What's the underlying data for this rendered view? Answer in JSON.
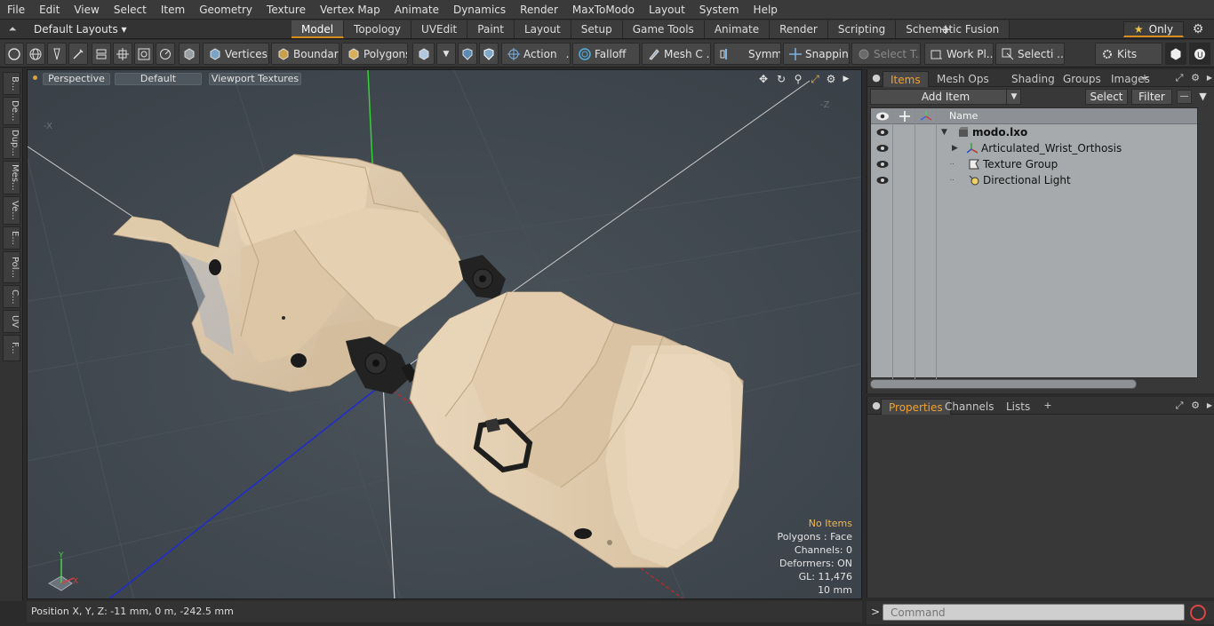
{
  "menu": [
    "File",
    "Edit",
    "View",
    "Select",
    "Item",
    "Geometry",
    "Texture",
    "Vertex Map",
    "Animate",
    "Dynamics",
    "Render",
    "MaxToModo",
    "Layout",
    "System",
    "Help"
  ],
  "layout_bar": {
    "layouts_label": "Default Layouts",
    "tabs": [
      "Model",
      "Topology",
      "UVEdit",
      "Paint",
      "Layout",
      "Setup",
      "Game Tools",
      "Animate",
      "Render",
      "Scripting",
      "Schematic Fusion"
    ],
    "active_tab": "Model",
    "only_label": "Only"
  },
  "toolbar": {
    "vertices": "Vertices",
    "boundary": "Boundary",
    "polygons": "Polygons",
    "action": "Action",
    "falloff": "Falloff",
    "mesh": "Mesh C ...",
    "symmetry": "Symm ...",
    "snapping": "Snapping",
    "select_t": "Select T...",
    "work_plane": "Work Pl...",
    "selection": "Selecti ...",
    "kits": "Kits"
  },
  "left_tabs": [
    "B...",
    "De...",
    "Dup...",
    "Mes...",
    "Ve...",
    "E...",
    "Pol...",
    "C...",
    "UV",
    "F..."
  ],
  "viewport": {
    "view_mode": "Perspective",
    "shading": "Default",
    "textures": "Viewport Textures",
    "info": {
      "selection": "No Items",
      "polygons": "Polygons : Face",
      "channels": "Channels: 0",
      "deformers": "Deformers: ON",
      "gl": "GL: 11,476",
      "scale": "10 mm"
    },
    "axis_x": "X",
    "axis_y": "Y"
  },
  "status": {
    "position": "Position X, Y, Z:  -11 mm, 0 m, -242.5 mm"
  },
  "items_panel": {
    "tabs": [
      "Items",
      "Mesh Ops",
      "Shading",
      "Groups",
      "Images"
    ],
    "active_tab": "Items",
    "add_item": "Add Item",
    "select": "Select",
    "filter": "Filter",
    "column_name": "Name",
    "items": [
      {
        "label": "modo.lxo",
        "level": 0,
        "expanded": true,
        "icon": "scene-icon"
      },
      {
        "label": "Articulated_Wrist_Orthosis",
        "level": 1,
        "expanded": false,
        "icon": "mesh-item-icon"
      },
      {
        "label": "Texture Group",
        "level": 1,
        "expanded": false,
        "icon": "texture-group-icon"
      },
      {
        "label": "Directional Light",
        "level": 1,
        "expanded": false,
        "icon": "light-icon"
      }
    ]
  },
  "props_panel": {
    "tabs": [
      "Properties",
      "Channels",
      "Lists"
    ],
    "active_tab": "Properties"
  },
  "command": {
    "placeholder": "Command"
  },
  "colors": {
    "accent": "#f1a12f",
    "viewport_bg": "#424a52",
    "model_skin": "#e3d0b4"
  }
}
